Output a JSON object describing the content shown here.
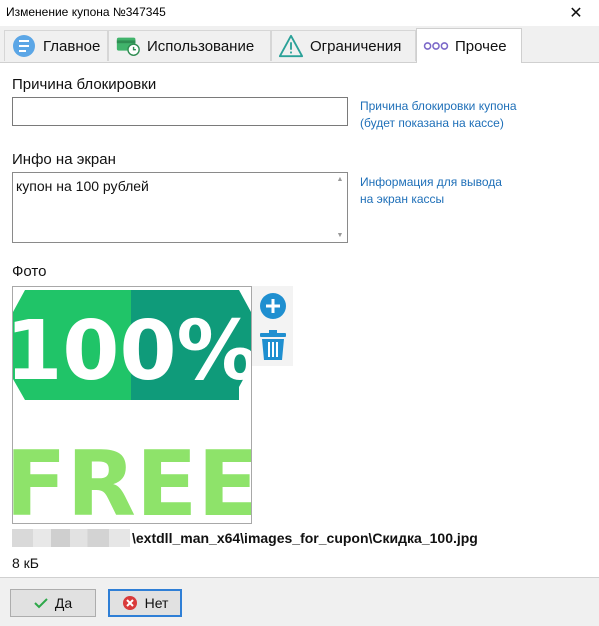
{
  "window": {
    "title": "Изменение купона №347345",
    "close_glyph": "✕"
  },
  "tabs": [
    {
      "label": "Главное",
      "icon": "info-circle-icon",
      "active": false
    },
    {
      "label": "Использование",
      "icon": "card-clock-icon",
      "active": false
    },
    {
      "label": "Ограничения",
      "icon": "warning-triangle-icon",
      "active": false
    },
    {
      "label": "Прочее",
      "icon": "three-dots-icon",
      "active": true
    }
  ],
  "block_reason": {
    "label": "Причина блокировки",
    "value": "",
    "hint_line1": "Причина блокировки купона",
    "hint_line2": "(будет показана на кассе)"
  },
  "screen_info": {
    "label": "Инфо на экран",
    "value": "купон на 100 рублей",
    "hint_line1": "Информация для вывода",
    "hint_line2": "на экран кассы"
  },
  "photo": {
    "label": "Фото",
    "image_text_top": "100%",
    "image_text_bottom": "FREE",
    "path": "\\extdll_man_x64\\images_for_cupon\\Скидка_100.jpg",
    "size": "8 кБ",
    "colors": {
      "light_green": "#20c468",
      "dark_teal": "#0f9b7a",
      "free_green": "#8ee36a",
      "action_blue": "#1f8fd0"
    }
  },
  "footer": {
    "ok_label": "Да",
    "cancel_label": "Нет"
  }
}
